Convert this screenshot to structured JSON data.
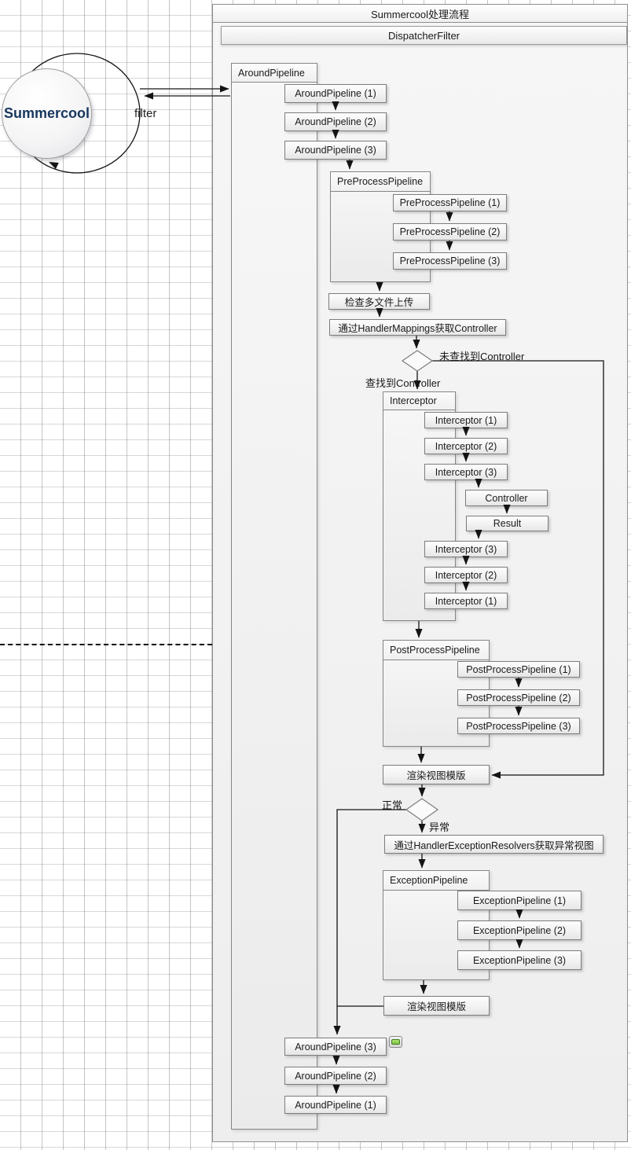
{
  "header": {
    "title": "Summercool处理流程",
    "lane_title": "DispatcherFilter"
  },
  "actor": {
    "name": "Summercool",
    "loop_label": "filter"
  },
  "pipelines": {
    "around": {
      "title": "AroundPipeline",
      "enter": [
        "AroundPipeline (1)",
        "AroundPipeline (2)",
        "AroundPipeline (3)"
      ],
      "exit": [
        "AroundPipeline (3)",
        "AroundPipeline (2)",
        "AroundPipeline (1)"
      ]
    },
    "preprocess": {
      "title": "PreProcessPipeline",
      "items": [
        "PreProcessPipeline (1)",
        "PreProcessPipeline (2)",
        "PreProcessPipeline (3)"
      ]
    },
    "interceptor": {
      "title": "Interceptor",
      "enter": [
        "Interceptor (1)",
        "Interceptor (2)",
        "Interceptor (3)"
      ],
      "core": [
        "Controller",
        "Result"
      ],
      "exit": [
        "Interceptor (3)",
        "Interceptor (2)",
        "Interceptor (1)"
      ]
    },
    "postprocess": {
      "title": "PostProcessPipeline",
      "items": [
        "PostProcessPipeline (1)",
        "PostProcessPipeline (2)",
        "PostProcessPipeline (3)"
      ]
    },
    "exception": {
      "title": "ExceptionPipeline",
      "items": [
        "ExceptionPipeline (1)",
        "ExceptionPipeline (2)",
        "ExceptionPipeline (3)"
      ]
    }
  },
  "steps": {
    "check_upload": "检查多文件上传",
    "get_controller": "通过HandlerMappings获取Controller",
    "render_view": "渲染视图模版",
    "get_exception_view": "通过HandlerExceptionResolvers获取异常视图",
    "render_exception_view": "渲染视图模版"
  },
  "decisions": {
    "controller_found": {
      "no": "未查找到Controller",
      "yes": "查找到Controller"
    },
    "result_state": {
      "normal": "正常",
      "error": "异常"
    }
  },
  "colors": {
    "actor_text": "#17365d",
    "accent_green": "#7ec142",
    "node_border": "#7d7d7d",
    "line": "#141414"
  }
}
